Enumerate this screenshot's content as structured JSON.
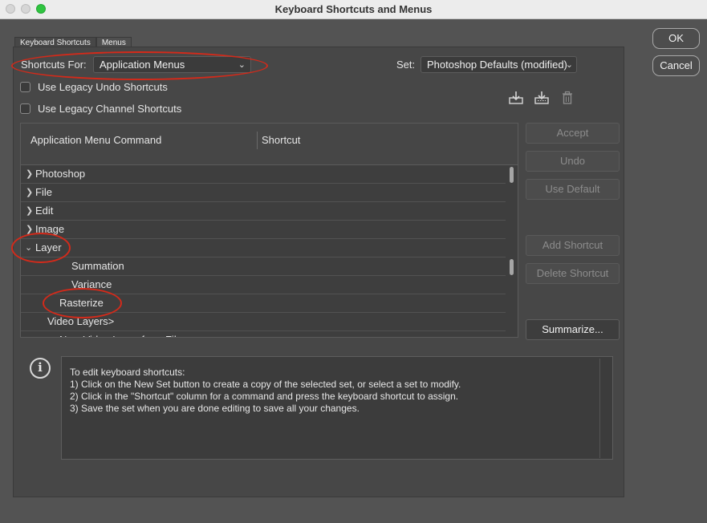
{
  "window": {
    "title": "Keyboard Shortcuts and Menus"
  },
  "tabs": [
    {
      "label": "Keyboard Shortcuts",
      "active": true
    },
    {
      "label": "Menus",
      "active": false
    }
  ],
  "shortcuts_for": {
    "label": "Shortcuts For:",
    "value": "Application Menus"
  },
  "set": {
    "label": "Set:",
    "value": "Photoshop Defaults (modified)"
  },
  "options": {
    "legacy_undo": {
      "label": "Use Legacy Undo Shortcuts",
      "checked": false
    },
    "legacy_channel": {
      "label": "Use Legacy Channel Shortcuts",
      "checked": false
    }
  },
  "toolbar_icons": [
    "save-set-icon",
    "save-set-as-icon",
    "delete-set-icon"
  ],
  "table": {
    "columns": [
      "Application Menu Command",
      "Shortcut"
    ],
    "rows": [
      {
        "label": "Photoshop",
        "expanded": false
      },
      {
        "label": "File",
        "expanded": false
      },
      {
        "label": "Edit",
        "expanded": false
      },
      {
        "label": "Image",
        "expanded": false
      },
      {
        "label": "Layer",
        "expanded": true
      },
      {
        "label": "Summation"
      },
      {
        "label": "Variance"
      },
      {
        "label": "Rasterize"
      },
      {
        "label": "Video Layers>"
      },
      {
        "label": "New Video Layer from File..."
      }
    ]
  },
  "side_buttons": {
    "accept": "Accept",
    "undo": "Undo",
    "use_default": "Use Default",
    "add_shortcut": "Add Shortcut",
    "delete_shortcut": "Delete Shortcut",
    "summarize": "Summarize..."
  },
  "dialog_buttons": {
    "ok": "OK",
    "cancel": "Cancel"
  },
  "info": {
    "lines": [
      "To edit keyboard shortcuts:",
      "1) Click on the New Set button to create a copy of the selected set, or select a set to modify.",
      "2) Click in the \"Shortcut\" column for a command and press the keyboard shortcut to assign.",
      "3) Save the set when you are done editing to save all your changes."
    ]
  },
  "annotation_color": "#d42a1a"
}
